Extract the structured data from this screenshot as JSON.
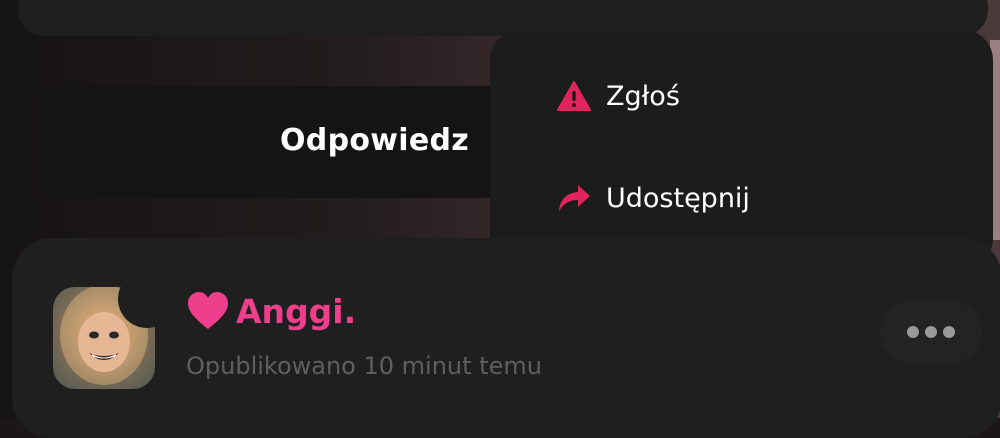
{
  "reply": {
    "label": "Odpowiedz"
  },
  "menu": {
    "items": [
      {
        "label": "Zgłoś",
        "icon": "warning-triangle-icon",
        "color": "#e0245e"
      },
      {
        "label": "Udostępnij",
        "icon": "share-arrow-icon",
        "color": "#e0245e"
      }
    ]
  },
  "post": {
    "username": "Anggi.",
    "username_color": "#ef3f8c",
    "heart_icon": "heart-icon",
    "published": "Opublikowano 10 minut temu",
    "more_icon": "more-horizontal-icon"
  }
}
